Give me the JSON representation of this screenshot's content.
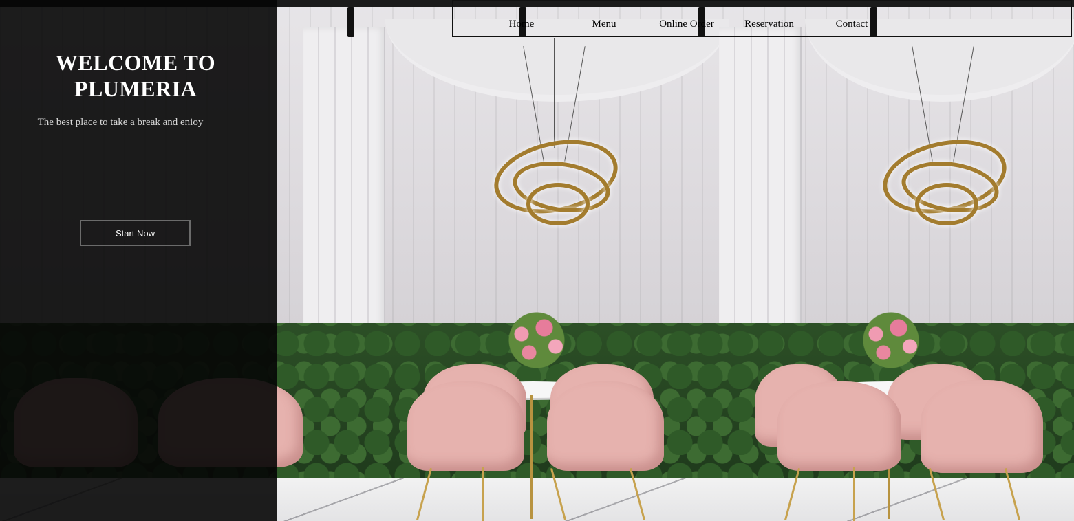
{
  "nav": {
    "items": [
      {
        "label": "Home"
      },
      {
        "label": "Menu"
      },
      {
        "label": "Online Order"
      },
      {
        "label": "Reservation"
      },
      {
        "label": "Contact"
      }
    ]
  },
  "hero": {
    "title_line1": "WELCOME TO",
    "title_line2": "PLUMERIA",
    "subtitle": "The best place to take a break and enioy",
    "button_label": "Start Now"
  },
  "colors": {
    "panel_overlay": "#060606",
    "chair_pink": "#e6b2ae",
    "brass": "#a37c2e"
  }
}
